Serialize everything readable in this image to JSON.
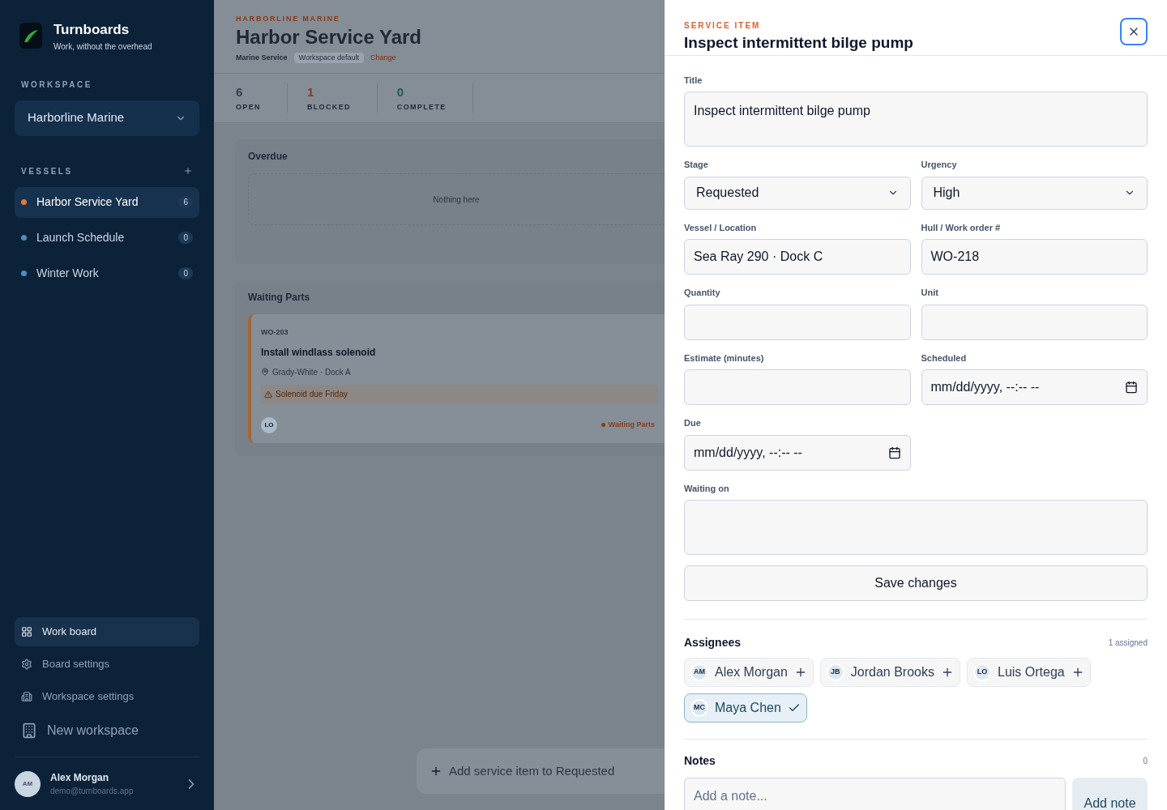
{
  "sidebar": {
    "brand": {
      "name": "Turnboards",
      "tagline": "Work, without the overhead"
    },
    "workspace_label": "WORKSPACE",
    "workspace": "Harborline Marine",
    "vessels_label": "VESSELS",
    "vessels": [
      {
        "name": "Harbor Service Yard",
        "count": "6",
        "selected": true,
        "color": "#e07b39"
      },
      {
        "name": "Launch Schedule",
        "count": "0",
        "selected": false,
        "color": "#4a8fc0"
      },
      {
        "name": "Winter Work",
        "count": "0",
        "selected": false,
        "color": "#4a8fc0"
      }
    ],
    "nav": [
      {
        "label": "Work board",
        "kind": "board",
        "selected": true
      },
      {
        "label": "Board settings",
        "kind": "gear",
        "selected": false
      },
      {
        "label": "Workspace settings",
        "kind": "building",
        "selected": false
      }
    ],
    "new_workspace": "New workspace",
    "user": {
      "initials": "AM",
      "name": "Alex Morgan",
      "email": "demo@turnboards.app"
    }
  },
  "main": {
    "org": "HARBORLINE MARINE",
    "title": "Harbor Service Yard",
    "meta": {
      "type": "Marine Service",
      "badge": "Workspace default",
      "link": "Change"
    },
    "stats": [
      {
        "value": "6",
        "label": "OPEN",
        "color": "#334155"
      },
      {
        "value": "1",
        "label": "BLOCKED",
        "color": "#8a3b12"
      },
      {
        "value": "0",
        "label": "COMPLETE",
        "color": "#1f5e3f"
      }
    ],
    "columns": [
      {
        "title": "Overdue",
        "empty_text": "Nothing here"
      },
      {
        "title": "Waiting Parts",
        "cards": [
          {
            "id": "WO-203",
            "title": "Install windlass solenoid",
            "location": "Grady-White · Dock A",
            "alert": "Solenoid due Friday",
            "assignee": "LO",
            "status": "Waiting Parts",
            "color": "#8a3b12"
          }
        ]
      }
    ],
    "add_button": "Add service item to Requested"
  },
  "drawer": {
    "eyebrow": "SERVICE ITEM",
    "title": "Inspect intermittent bilge pump",
    "fields": [
      {
        "label": "Title",
        "kind": "textarea",
        "value": "Inspect intermittent bilge pump"
      },
      {
        "label": "Stage",
        "kind": "select",
        "value": "Requested"
      },
      {
        "label": "Urgency",
        "kind": "select",
        "value": "High"
      },
      {
        "label": "Vessel / Location",
        "kind": "text",
        "value": "Sea Ray 290 · Dock C"
      },
      {
        "label": "Hull / Work order #",
        "kind": "text",
        "value": "WO-218"
      },
      {
        "label": "Quantity",
        "kind": "text"
      },
      {
        "label": "Unit",
        "kind": "text"
      },
      {
        "label": "Estimate (minutes)",
        "kind": "text"
      },
      {
        "label": "Scheduled",
        "kind": "datetime",
        "value": "mm/dd/yyyy, --:-- --"
      },
      {
        "label": "Due",
        "kind": "datetime",
        "value": "mm/dd/yyyy, --:-- --"
      },
      {
        "label": "Waiting on",
        "kind": "textarea"
      }
    ],
    "save": "Save changes",
    "assignees": {
      "title": "Assignees",
      "count": "1 assigned",
      "people": [
        {
          "initials": "AM",
          "name": "Alex Morgan",
          "selected": false
        },
        {
          "initials": "JB",
          "name": "Jordan Brooks",
          "selected": false
        },
        {
          "initials": "LO",
          "name": "Luis Ortega",
          "selected": false
        },
        {
          "initials": "MC",
          "name": "Maya Chen",
          "selected": true
        }
      ]
    },
    "notes": {
      "title": "Notes",
      "count": "0",
      "placeholder": "Add a note...",
      "button": "Add note"
    }
  }
}
